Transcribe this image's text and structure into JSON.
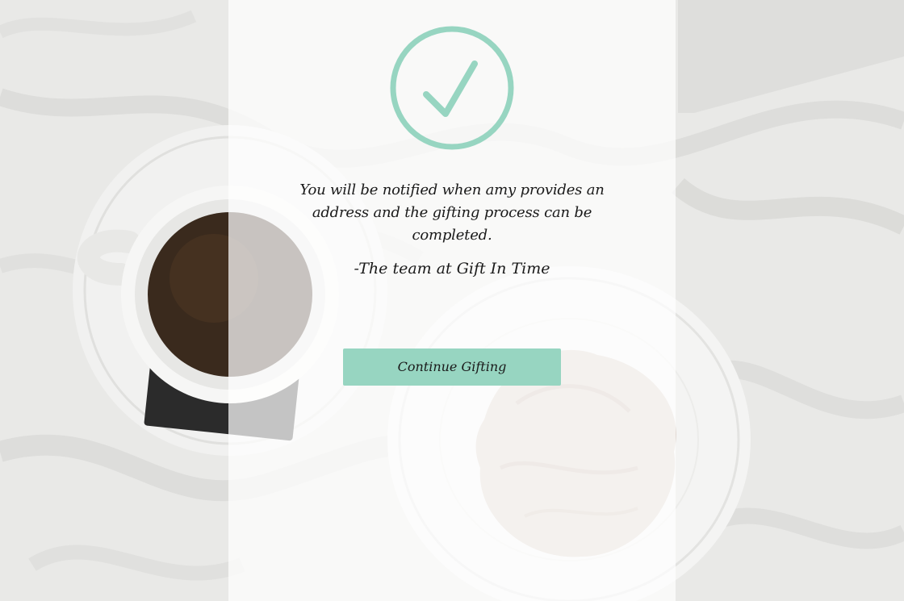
{
  "confirmation": {
    "message": "You will be notified when amy provides an address and the gifting process can be completed.",
    "signature": "-The team at Gift In Time",
    "continue_label": "Continue Gifting"
  },
  "icons": {
    "status": "checkmark-circle-icon"
  },
  "colors": {
    "accent": "#97d5c1",
    "text": "#1a1a1a",
    "panel_overlay": "rgba(255,255,255,0.72)"
  }
}
